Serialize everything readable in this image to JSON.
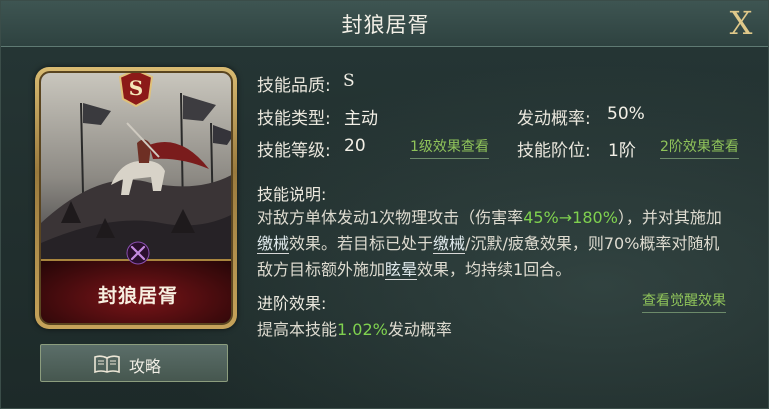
{
  "title": "封狼居胥",
  "close_label": "X",
  "card": {
    "name": "封狼居胥",
    "grade": "S"
  },
  "guide_button": {
    "label": "攻略",
    "icon": "book-icon"
  },
  "info": {
    "quality_label": "技能品质:",
    "quality_value": "S",
    "type_label": "技能类型:",
    "type_value": "主动",
    "rate_label": "发动概率:",
    "rate_value": "50%",
    "level_label": "技能等级:",
    "level_value": "20",
    "level1_link": "1级效果查看",
    "stage_label": "技能阶位:",
    "stage_value": "1阶",
    "stage2_link": "2阶效果查看"
  },
  "description": {
    "title": "技能说明:",
    "part1": "对敌方单体发动1次物理攻击（伤害率",
    "damage_rate": "45%→180%",
    "part2": "），并对其施加",
    "kw_disarm1": "缴械",
    "part3": "效果。若目标已处于",
    "kw_disarm2": "缴械",
    "part4": "/沉默/疲惫效果，则70%概率对随机敌方目标额外施加",
    "kw_stun": "眩晕",
    "part5": "效果，均持续1回合。"
  },
  "advance": {
    "title": "进阶效果:",
    "awaken_link": "查看觉醒效果",
    "prefix": "提高本技能",
    "value": "1.02%",
    "suffix": "发动概率"
  },
  "colors": {
    "accent_green": "#7fd14f",
    "gold": "#e0c98a",
    "banner_red": "#7a1418"
  }
}
